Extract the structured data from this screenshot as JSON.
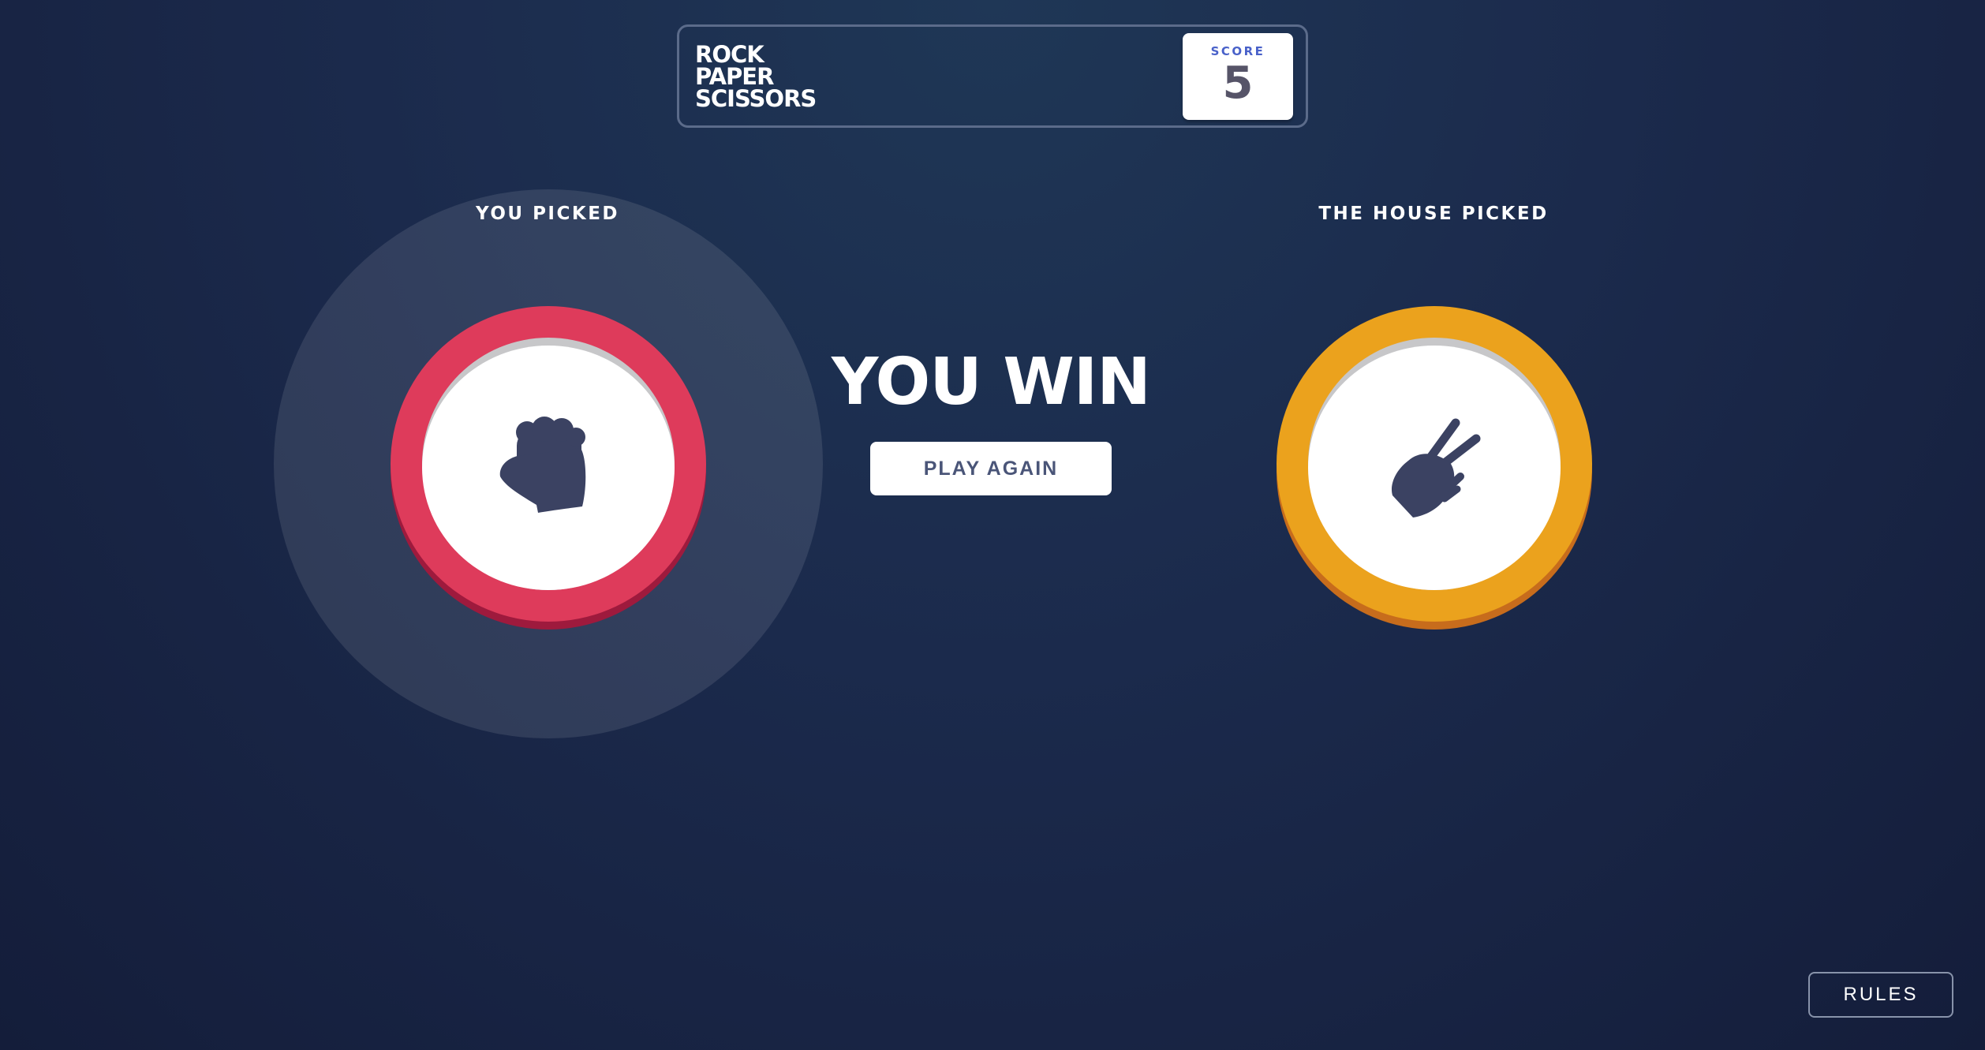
{
  "header": {
    "logo_lines": [
      "ROCK",
      "PAPER",
      "SCISSORS"
    ],
    "score_label": "SCORE",
    "score_value": "5"
  },
  "player": {
    "label": "YOU PICKED",
    "pick": "rock",
    "icon": "rock-fist-icon",
    "color": "#de3b5b",
    "is_winner": true
  },
  "house": {
    "label": "THE HOUSE PICKED",
    "pick": "scissors",
    "icon": "scissors-hand-icon",
    "color": "#eba21d"
  },
  "result": {
    "text": "YOU WIN",
    "play_again_label": "PLAY AGAIN"
  },
  "rules_label": "RULES",
  "colors": {
    "background": "#1b2a4c",
    "header_border": "#5b6b8a",
    "score_value": "#565468",
    "icon_fill": "#3b4262"
  }
}
